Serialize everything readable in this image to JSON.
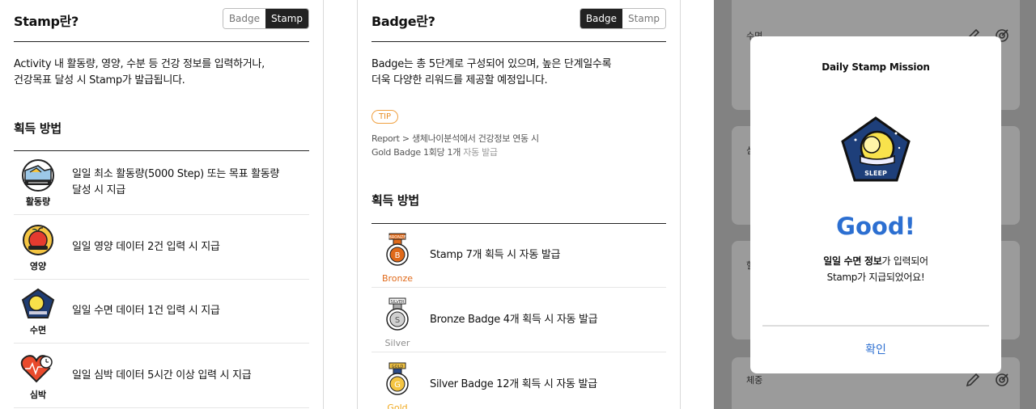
{
  "stamp_panel": {
    "title": "Stamp란?",
    "toggle": {
      "badge": "Badge",
      "stamp": "Stamp",
      "active": "stamp"
    },
    "description": [
      "Activity 내 활동량, 영양, 수분 등 건강 정보를 입력하거나,",
      "건강목표 달성 시 Stamp가 발급됩니다."
    ],
    "section_title": "획득 방법",
    "items": [
      {
        "icon": "activity-icon",
        "caption": "활동량",
        "lines": [
          "일일 최소 활동량(5000 Step) 또는 목표 활동량",
          "달성 시 지급"
        ]
      },
      {
        "icon": "nutrition-icon",
        "caption": "영양",
        "lines": [
          "일일 영양 데이터 2건 입력 시 지급"
        ]
      },
      {
        "icon": "sleep-icon",
        "caption": "수면",
        "lines": [
          "일일 수면 데이터 1건 입력 시 지급"
        ]
      },
      {
        "icon": "heart-rate-icon",
        "caption": "심박",
        "lines": [
          "일일 심박 데이터 5시간 이상 입력 시 지급"
        ]
      }
    ]
  },
  "badge_panel": {
    "title": "Badge란?",
    "toggle": {
      "badge": "Badge",
      "stamp": "Stamp",
      "active": "badge"
    },
    "description": [
      "Badge는 총 5단계로 구성되어 있으며, 높은 단계일수록",
      "더욱 다양한 리워드를 제공할 예정입니다."
    ],
    "tip_label": "TIP",
    "tip_line1": "Report > 생체나이분석에서 건강정보 연동 시",
    "tip_line2_a": "Gold Badge 1회당 1개",
    "tip_line2_b": " 자동 발급",
    "section_title": "획득 방법",
    "items": [
      {
        "icon": "bronze-medal-icon",
        "caption": "Bronze",
        "ribbon": "BRONZE",
        "letter": "B",
        "color": "#e06a1a",
        "text": "Stamp 7개 획득 시 자동 발급"
      },
      {
        "icon": "silver-medal-icon",
        "caption": "Silver",
        "ribbon": "SILVER",
        "letter": "S",
        "color": "#8c8c8c",
        "text": "Bronze Badge 4개 획득 시 자동 발급"
      },
      {
        "icon": "gold-medal-icon",
        "caption": "Gold",
        "ribbon": "GOLD",
        "letter": "G",
        "color": "#f0a81c",
        "text": "Silver Badge 12개 획득 시 자동 발급"
      }
    ]
  },
  "background_cards": [
    {
      "label": "수면"
    },
    {
      "label": "심"
    },
    {
      "label": "혈"
    },
    {
      "label": "체중"
    }
  ],
  "modal": {
    "title": "Daily Stamp Mission",
    "badge_icon": "sleep-stamp-icon",
    "badge_text": "SLEEP",
    "headline": "Good!",
    "message_bold": "일일 수면 정보",
    "message_rest": "가 입력되어",
    "message_line2": "Stamp가 지급되었어요!",
    "confirm_label": "확인"
  },
  "colors": {
    "accent_blue": "#2c6fd1",
    "tip_orange": "#e8902a",
    "dark": "#222222",
    "overlay": "#828282"
  }
}
